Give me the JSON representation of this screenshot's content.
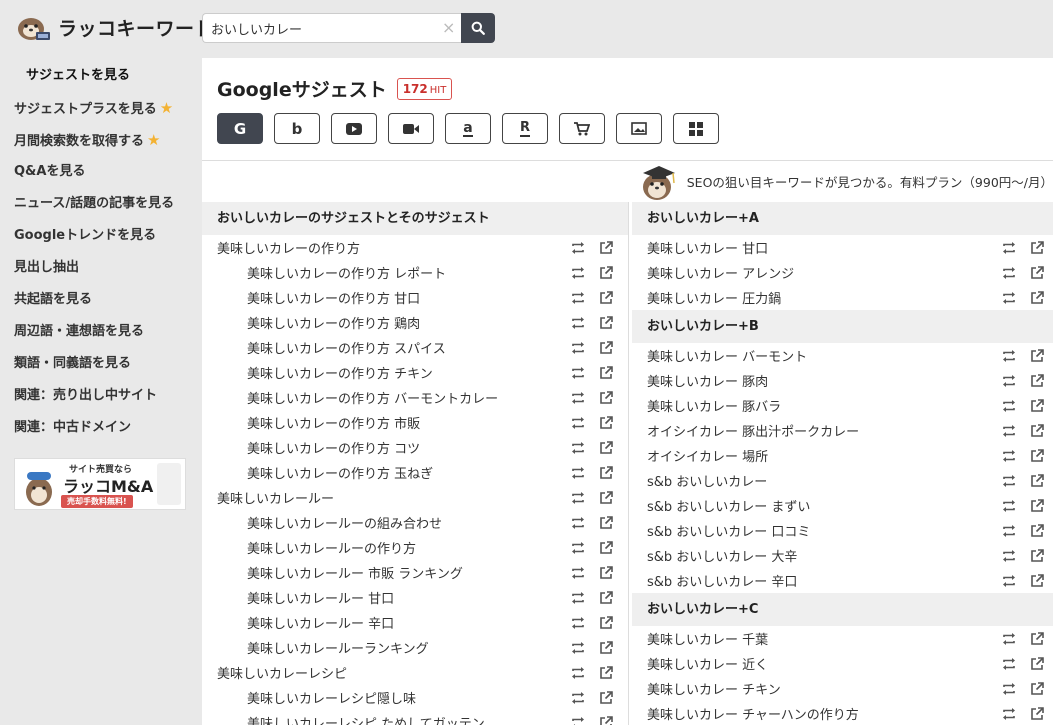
{
  "app": {
    "logo_text": "ラッコキーワード"
  },
  "search": {
    "value": "おいしいカレー",
    "clear_label": "×"
  },
  "sidebar": {
    "items": [
      {
        "label": "サジェストを見る",
        "active": true,
        "star": false
      },
      {
        "label": "サジェストプラスを見る",
        "active": false,
        "star": true
      },
      {
        "label": "月間検索数を取得する",
        "active": false,
        "star": true
      },
      {
        "label": "Q&Aを見る",
        "active": false,
        "star": false
      },
      {
        "label": "ニュース/話題の記事を見る",
        "active": false,
        "star": false
      },
      {
        "label": "Googleトレンドを見る",
        "active": false,
        "star": false
      },
      {
        "label": "見出し抽出",
        "active": false,
        "star": false
      },
      {
        "label": "共起語を見る",
        "active": false,
        "star": false
      },
      {
        "label": "周辺語・連想語を見る",
        "active": false,
        "star": false
      },
      {
        "label": "類語・同義語を見る",
        "active": false,
        "star": false
      },
      {
        "label": "関連：売り出し中サイト",
        "active": false,
        "star": false
      },
      {
        "label": "関連：中古ドメイン",
        "active": false,
        "star": false
      }
    ],
    "banner": {
      "top_text": "サイト売買なら",
      "main_text": "ラッコM&A",
      "sub_text": "売却手数料無料!"
    }
  },
  "main": {
    "title": "Googleサジェスト",
    "hit_count": "172",
    "hit_unit": "HIT",
    "engines": [
      {
        "name": "google",
        "icon": "G",
        "active": true
      },
      {
        "name": "bing",
        "icon": "b",
        "active": false
      },
      {
        "name": "youtube",
        "icon": "youtube-icon",
        "active": false
      },
      {
        "name": "video",
        "icon": "video-icon",
        "active": false
      },
      {
        "name": "amazon",
        "icon": "a",
        "active": false
      },
      {
        "name": "rakuten",
        "icon": "R",
        "active": false
      },
      {
        "name": "shopping",
        "icon": "cart-icon",
        "active": false
      },
      {
        "name": "image",
        "icon": "image-icon",
        "active": false
      },
      {
        "name": "apps",
        "icon": "grid-icon",
        "active": false
      }
    ],
    "promo_text": "SEOの狙い目キーワードが見つかる。有料プラン（990円〜/月）",
    "left_section": {
      "title": "おいしいカレーのサジェストとそのサジェスト",
      "rows": [
        {
          "text": "美味しいカレーの作り方",
          "level": 0
        },
        {
          "text": "美味しいカレーの作り方 レポート",
          "level": 1
        },
        {
          "text": "美味しいカレーの作り方 甘口",
          "level": 1
        },
        {
          "text": "美味しいカレーの作り方 鶏肉",
          "level": 1
        },
        {
          "text": "美味しいカレーの作り方 スパイス",
          "level": 1
        },
        {
          "text": "美味しいカレーの作り方 チキン",
          "level": 1
        },
        {
          "text": "美味しいカレーの作り方 バーモントカレー",
          "level": 1
        },
        {
          "text": "美味しいカレーの作り方 市販",
          "level": 1
        },
        {
          "text": "美味しいカレーの作り方 コツ",
          "level": 1
        },
        {
          "text": "美味しいカレーの作り方 玉ねぎ",
          "level": 1
        },
        {
          "text": "美味しいカレールー",
          "level": 0
        },
        {
          "text": "美味しいカレールーの組み合わせ",
          "level": 1
        },
        {
          "text": "美味しいカレールーの作り方",
          "level": 1
        },
        {
          "text": "美味しいカレールー 市販 ランキング",
          "level": 1
        },
        {
          "text": "美味しいカレールー 甘口",
          "level": 1
        },
        {
          "text": "美味しいカレールー 辛口",
          "level": 1
        },
        {
          "text": "美味しいカレールーランキング",
          "level": 1
        },
        {
          "text": "美味しいカレーレシピ",
          "level": 0
        },
        {
          "text": "美味しいカレーレシピ隠し味",
          "level": 1
        },
        {
          "text": "美味しいカレーレシピ ためしてガッテン",
          "level": 1
        }
      ]
    },
    "right_sections": [
      {
        "title": "おいしいカレー+A",
        "rows": [
          "美味しいカレー 甘口",
          "美味しいカレー アレンジ",
          "美味しいカレー 圧力鍋"
        ]
      },
      {
        "title": "おいしいカレー+B",
        "rows": [
          "美味しいカレー バーモント",
          "美味しいカレー 豚肉",
          "美味しいカレー 豚バラ",
          "オイシイカレー 豚出汁ポークカレー",
          "オイシイカレー 場所",
          "s&b おいしいカレー",
          "s&b おいしいカレー まずい",
          "s&b おいしいカレー 口コミ",
          "s&b おいしいカレー 大辛",
          "s&b おいしいカレー 辛口"
        ]
      },
      {
        "title": "おいしいカレー+C",
        "rows": [
          "美味しいカレー 千葉",
          "美味しいカレー 近く",
          "美味しいカレー チキン",
          "美味しいカレー チャーハンの作り方"
        ]
      }
    ]
  }
}
